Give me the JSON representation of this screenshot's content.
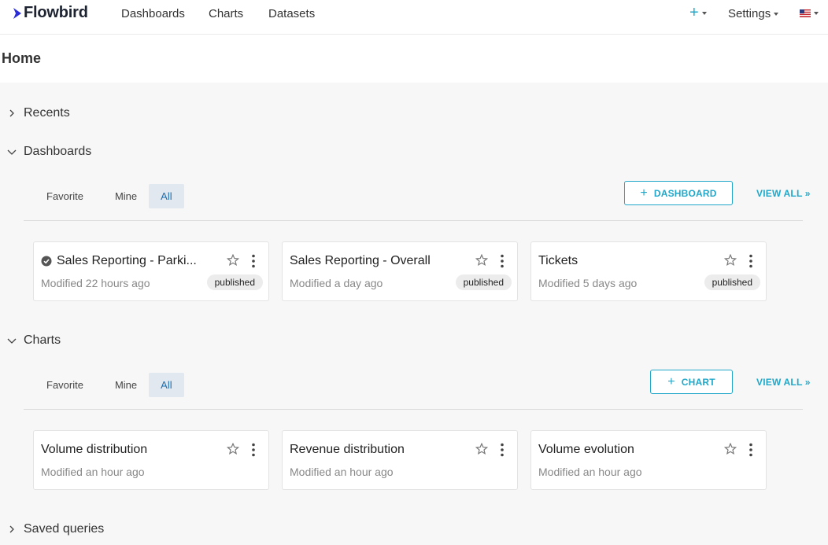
{
  "nav": {
    "logo_text": "Flowbird",
    "links": [
      "Dashboards",
      "Charts",
      "Datasets"
    ],
    "plus_label": "+",
    "settings_label": "Settings"
  },
  "home_title": "Home",
  "sections": {
    "recents": "Recents",
    "dashboards": "Dashboards",
    "charts": "Charts",
    "saved_queries": "Saved queries"
  },
  "tabs": [
    "Favorite",
    "Mine",
    "All"
  ],
  "buttons": {
    "dashboard": "DASHBOARD",
    "chart": "CHART",
    "view_all": "VIEW ALL »"
  },
  "dashboard_cards": [
    {
      "title": "Sales Reporting - Parki...",
      "modified": "Modified 22 hours ago",
      "status": "published",
      "verified": true
    },
    {
      "title": "Sales Reporting - Overall",
      "modified": "Modified a day ago",
      "status": "published",
      "verified": false
    },
    {
      "title": "Tickets",
      "modified": "Modified 5 days ago",
      "status": "published",
      "verified": false
    }
  ],
  "chart_cards": [
    {
      "title": "Volume distribution",
      "modified": "Modified an hour ago"
    },
    {
      "title": "Revenue distribution",
      "modified": "Modified an hour ago"
    },
    {
      "title": "Volume evolution",
      "modified": "Modified an hour ago"
    }
  ],
  "colors": {
    "accent": "#20a7c9",
    "active_tab_bg": "#e2e8ef"
  }
}
